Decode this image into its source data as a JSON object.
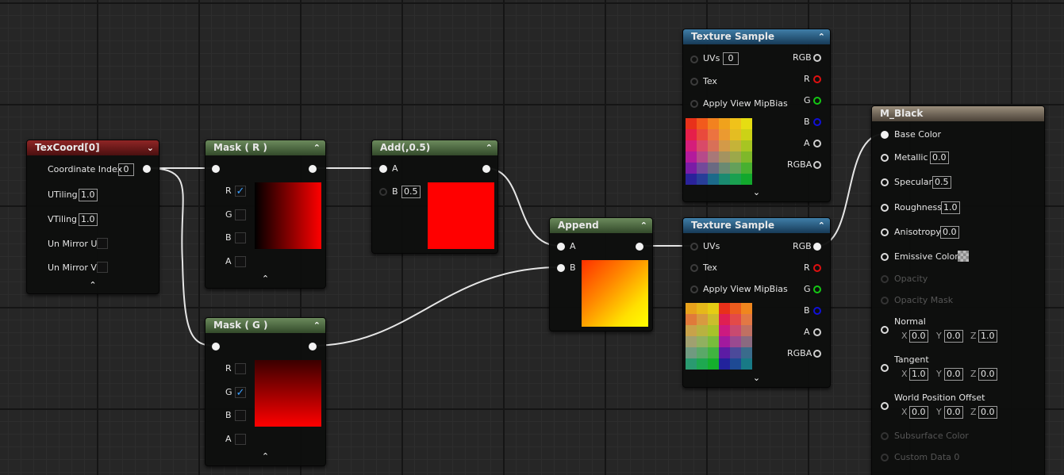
{
  "nodes": {
    "texcoord": {
      "title": "TexCoord[0]",
      "coordinate_index_label": "Coordinate Index",
      "coordinate_index_value": "0",
      "utiling_label": "UTiling",
      "utiling_value": "1.0",
      "vtiling_label": "VTiling",
      "vtiling_value": "1.0",
      "unmirror_u_label": "Un Mirror U",
      "unmirror_v_label": "Un Mirror V"
    },
    "mask_r": {
      "title": "Mask ( R )",
      "r_label": "R",
      "g_label": "G",
      "b_label": "B",
      "a_label": "A"
    },
    "mask_g": {
      "title": "Mask ( G )",
      "r_label": "R",
      "g_label": "G",
      "b_label": "B",
      "a_label": "A"
    },
    "add": {
      "title": "Add(,0.5)",
      "a_label": "A",
      "b_label": "B",
      "b_value": "0.5"
    },
    "append": {
      "title": "Append",
      "a_label": "A",
      "b_label": "B"
    },
    "texture_sample_1": {
      "title": "Texture Sample",
      "uvs_label": "UVs",
      "uvs_value": "0",
      "tex_label": "Tex",
      "mipbias_label": "Apply View MipBias",
      "rgb_label": "RGB",
      "r_label": "R",
      "g_label": "G",
      "b_label": "B",
      "a_label": "A",
      "rgba_label": "RGBA"
    },
    "texture_sample_2": {
      "title": "Texture Sample",
      "uvs_label": "UVs",
      "tex_label": "Tex",
      "mipbias_label": "Apply View MipBias",
      "rgb_label": "RGB",
      "r_label": "R",
      "g_label": "G",
      "b_label": "B",
      "a_label": "A",
      "rgba_label": "RGBA"
    },
    "material": {
      "title": "M_Black",
      "base_color_label": "Base Color",
      "metallic_label": "Metallic",
      "metallic_value": "0.0",
      "specular_label": "Specular",
      "specular_value": "0.5",
      "roughness_label": "Roughness",
      "roughness_value": "1.0",
      "anisotropy_label": "Anisotropy",
      "anisotropy_value": "0.0",
      "emissive_label": "Emissive Color",
      "opacity_label": "Opacity",
      "opacity_mask_label": "Opacity Mask",
      "normal_label": "Normal",
      "normal_x": "0.0",
      "normal_y": "0.0",
      "normal_z": "1.0",
      "tangent_label": "Tangent",
      "tangent_x": "1.0",
      "tangent_y": "0.0",
      "tangent_z": "0.0",
      "wpo_label": "World Position Offset",
      "wpo_x": "0.0",
      "wpo_y": "0.0",
      "wpo_z": "0.0",
      "x_label": "X",
      "y_label": "Y",
      "z_label": "Z",
      "subsurface_label": "Subsurface Color",
      "custom_data_label": "Custom Data 0"
    }
  },
  "colors": {
    "wire": "#e8e8e8",
    "header_red": "#8f2525",
    "header_green": "#6b8a5c",
    "header_blue": "#3f7ea8",
    "header_tan": "#9a8e7c"
  }
}
